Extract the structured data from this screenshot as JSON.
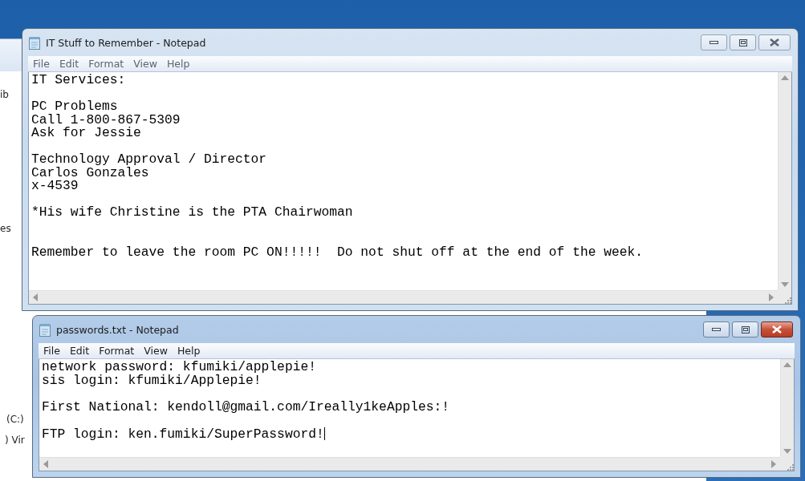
{
  "background_window": {
    "labels": [
      {
        "text": "ib"
      },
      {
        "text": "es"
      },
      {
        "text": "(C:)"
      },
      {
        "text": ") Vir"
      }
    ]
  },
  "windows": [
    {
      "title": "IT Stuff to Remember - Notepad",
      "active": false,
      "menu": [
        "File",
        "Edit",
        "Format",
        "View",
        "Help"
      ],
      "lines": [
        {
          "kind": "text",
          "text": "IT Services:"
        },
        {
          "kind": "blank"
        },
        {
          "kind": "text",
          "text": "PC Problems"
        },
        {
          "kind": "text",
          "text": "Call 1-800-867-5309"
        },
        {
          "kind": "text",
          "text": "Ask for Jessie"
        },
        {
          "kind": "blank"
        },
        {
          "kind": "text",
          "text": "Technology Approval / Director"
        },
        {
          "kind": "text",
          "text": "Carlos Gonzales"
        },
        {
          "kind": "text",
          "text": "x-4539"
        },
        {
          "kind": "blank"
        },
        {
          "kind": "text",
          "text": "*His wife Christine is the PTA Chairwoman"
        },
        {
          "kind": "blank"
        },
        {
          "kind": "blank"
        },
        {
          "kind": "text",
          "text": "Remember to leave the room PC ON!!!!!  Do not shut off at the end of the week."
        }
      ]
    },
    {
      "title": "passwords.txt - Notepad",
      "active": true,
      "menu": [
        "File",
        "Edit",
        "Format",
        "View",
        "Help"
      ],
      "lines": [
        {
          "kind": "text",
          "text": "network password: kfumiki/applepie!"
        },
        {
          "kind": "text",
          "text": "sis login: kfumiki/Applepie!"
        },
        {
          "kind": "blank"
        },
        {
          "kind": "text",
          "text": "First National: kendoll@gmail.com/Ireally1keApples:!"
        },
        {
          "kind": "blank"
        },
        {
          "kind": "text",
          "text": "FTP login: ken.fumiki/SuperPassword!",
          "caret": true
        }
      ]
    }
  ]
}
